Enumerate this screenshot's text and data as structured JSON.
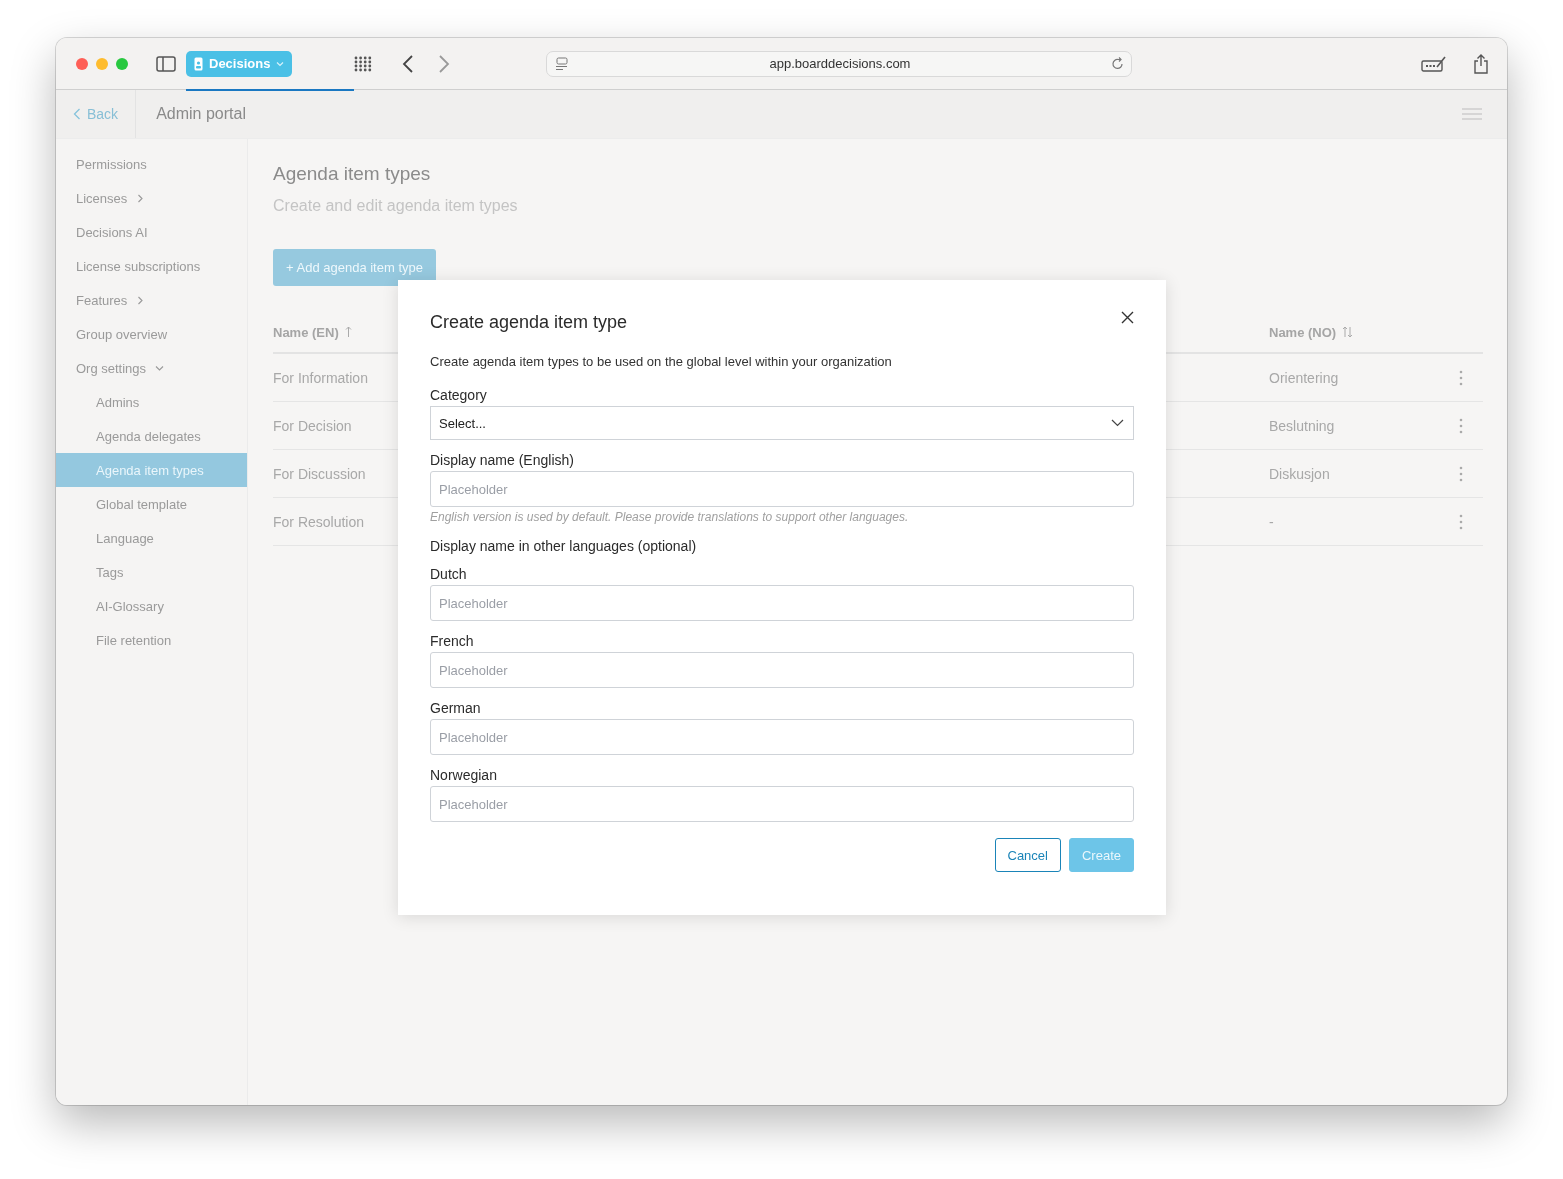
{
  "browser": {
    "tab": {
      "label": "Decisions",
      "selected": true
    },
    "url": "app.boarddecisions.com"
  },
  "header": {
    "back": "Back",
    "title": "Admin portal"
  },
  "sidebar": {
    "items": [
      {
        "label": "Permissions",
        "selected": false
      },
      {
        "label": "Licenses",
        "selected": false,
        "expanded": false
      },
      {
        "label": "Decisions AI",
        "selected": false
      },
      {
        "label": "License subscriptions",
        "selected": false
      },
      {
        "label": "Features",
        "selected": false,
        "expanded": false
      },
      {
        "label": "Group overview",
        "selected": false
      },
      {
        "label": "Org settings",
        "selected": false,
        "expanded": true,
        "children": [
          {
            "label": "Admins",
            "selected": false
          },
          {
            "label": "Agenda delegates",
            "selected": false
          },
          {
            "label": "Agenda item types",
            "selected": true
          },
          {
            "label": "Global template",
            "selected": false
          },
          {
            "label": "Language",
            "selected": false
          },
          {
            "label": "Tags",
            "selected": false
          },
          {
            "label": "AI-Glossary",
            "selected": false
          },
          {
            "label": "File retention",
            "selected": false
          }
        ]
      }
    ]
  },
  "page": {
    "title": "Agenda item types",
    "subtitle": "Create and edit agenda item types",
    "add_button": "+ Add agenda item type"
  },
  "table": {
    "columns": [
      {
        "label": "Name (EN)",
        "sorted": true
      },
      {
        "label": "Name (NO)",
        "sorted": false
      }
    ],
    "rows": [
      [
        "For Information",
        "Orientering"
      ],
      [
        "For Decision",
        "Beslutning"
      ],
      [
        "For Discussion",
        "Diskusjon"
      ],
      [
        "For Resolution",
        "-"
      ]
    ]
  },
  "dialog": {
    "title": "Create agenda item type",
    "description": "Create agenda item types to be used on the global level within your organization",
    "items": [
      {
        "kind": "select",
        "label": "Category",
        "value": "Select..."
      },
      {
        "kind": "text",
        "label": "Display name (English)",
        "placeholder": "Placeholder",
        "hint": "English version is used by default. Please provide translations to support other languages."
      },
      {
        "kind": "heading",
        "label": "Display name in other languages (optional)"
      },
      {
        "kind": "text",
        "label": "Dutch",
        "placeholder": "Placeholder"
      },
      {
        "kind": "text",
        "label": "French",
        "placeholder": "Placeholder"
      },
      {
        "kind": "text",
        "label": "German",
        "placeholder": "Placeholder"
      },
      {
        "kind": "text",
        "label": "Norwegian",
        "placeholder": "Placeholder"
      }
    ],
    "buttons": [
      {
        "label": "Cancel",
        "kind": "secondary"
      },
      {
        "label": "Create",
        "kind": "primary"
      }
    ]
  }
}
